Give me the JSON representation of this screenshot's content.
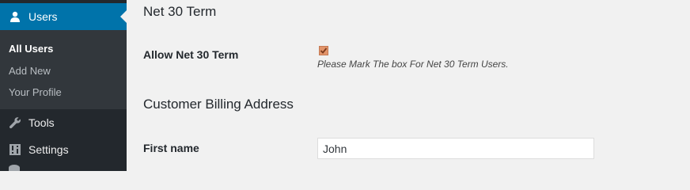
{
  "sidebar": {
    "active_menu": {
      "label": "Users",
      "icon": "user-icon"
    },
    "submenu": [
      {
        "label": "All Users",
        "current": true
      },
      {
        "label": "Add New",
        "current": false
      },
      {
        "label": "Your Profile",
        "current": false
      }
    ],
    "items": [
      {
        "label": "Tools",
        "icon": "wrench-icon"
      },
      {
        "label": "Settings",
        "icon": "settings-sliders-icon"
      }
    ]
  },
  "section_net30": {
    "title": "Net 30 Term",
    "allow_label": "Allow Net 30 Term",
    "checkbox_checked": true,
    "description": "Please Mark The box For Net 30 Term Users."
  },
  "section_billing": {
    "title": "Customer Billing Address",
    "first_name_label": "First name",
    "first_name_value": "John"
  },
  "colors": {
    "sidebar_bg": "#23282d",
    "submenu_bg": "#32373c",
    "accent": "#0073aa",
    "page_bg": "#f1f1f1",
    "checkbox": "#e2946a"
  }
}
